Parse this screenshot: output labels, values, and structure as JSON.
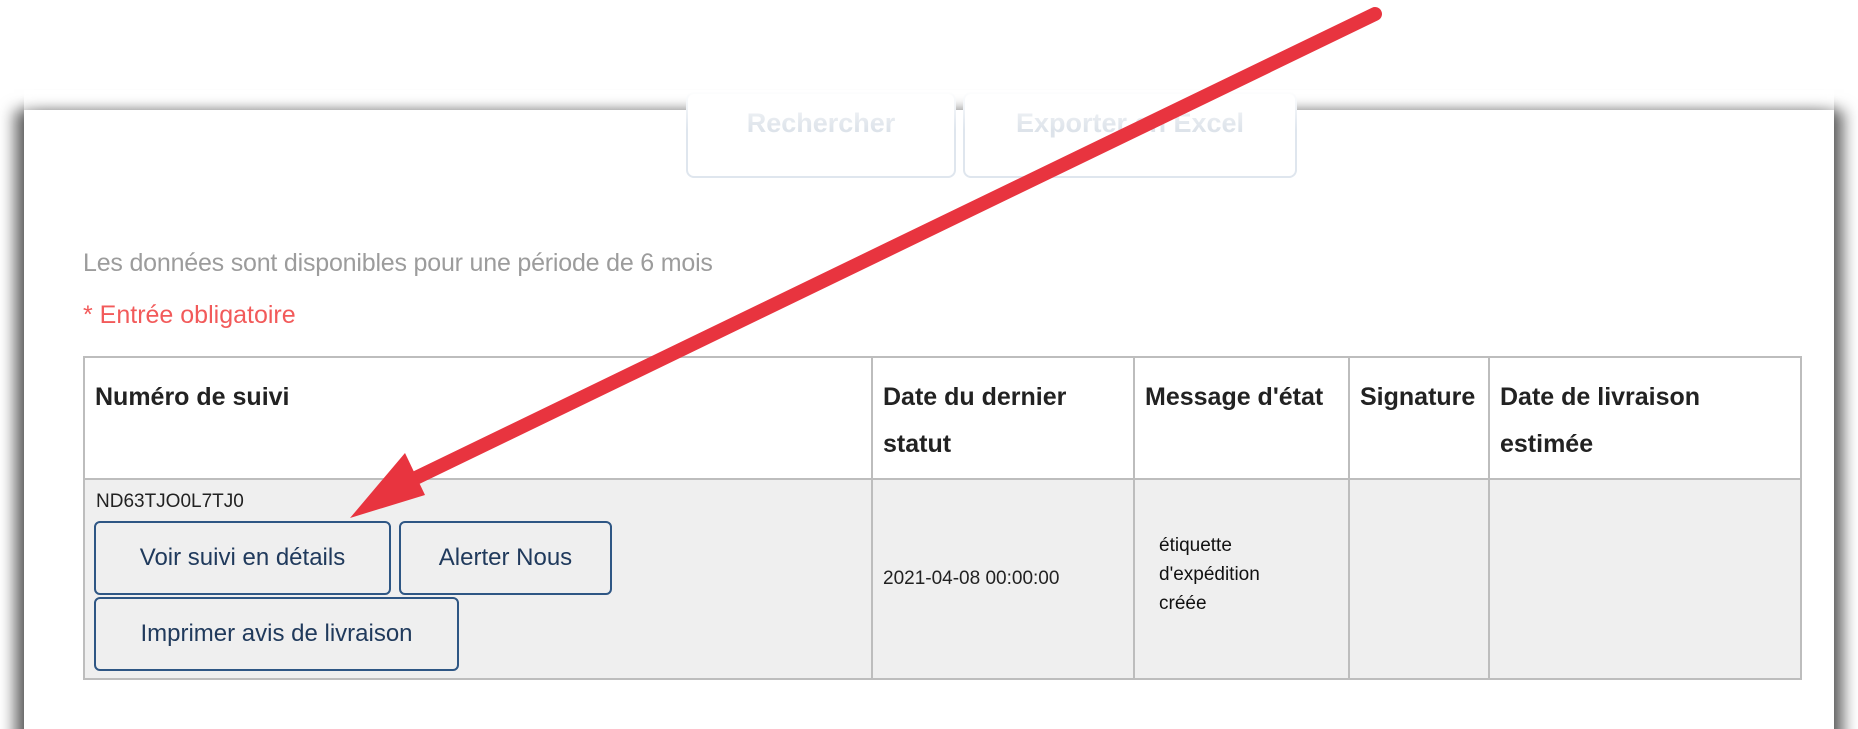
{
  "toolbar": {
    "search_label": "Rechercher",
    "export_label": "Exporter en Excel"
  },
  "info": {
    "availability": "Les données sont disponibles pour une période de 6 mois",
    "required_note": "* Entrée obligatoire"
  },
  "table": {
    "headers": [
      "Numéro de suivi",
      "Date du dernier statut",
      "Message d'état",
      "Signature",
      "Date de livraison estimée"
    ],
    "rows": [
      {
        "tracking_number": "ND63TJO0L7TJ0",
        "details_button": "Voir suivi en détails",
        "alert_button": "Alerter Nous",
        "print_button": "Imprimer avis de livraison",
        "last_status_date": "2021-04-08 00:00:00",
        "status_message": "étiquette d'expédition créée",
        "signature": "",
        "estimated_delivery": ""
      }
    ]
  },
  "annotation": {
    "arrow_color": "#e8343f"
  }
}
